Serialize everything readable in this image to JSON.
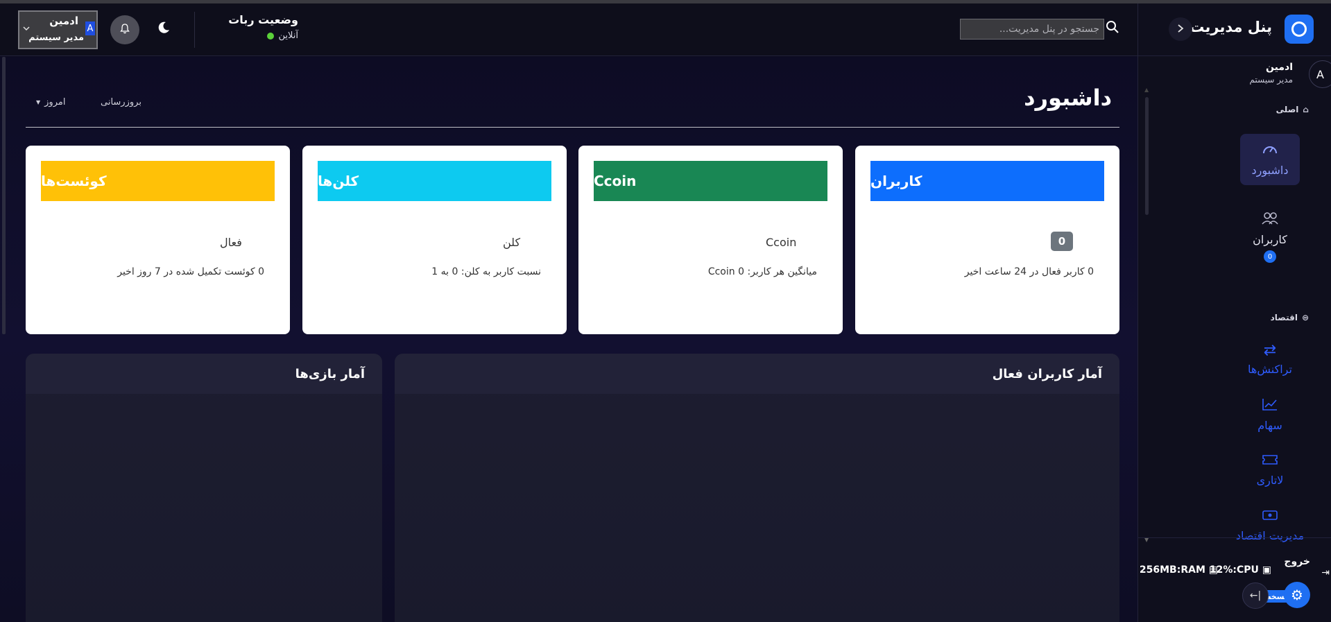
{
  "sidebar": {
    "title": "پنل مدیریت",
    "user": {
      "avatar_letter": "A",
      "name": "ادمین",
      "role": "مدیر سیستم"
    },
    "sections": [
      {
        "label": "اصلی",
        "icon": "home-icon"
      },
      {
        "label": "اقتصاد",
        "icon": "coin-icon"
      }
    ],
    "items": [
      {
        "label": "داشبورد",
        "icon": "gauge-icon",
        "active": true
      },
      {
        "label": "کاربران",
        "icon": "users-icon",
        "badge": "0"
      },
      {
        "label": "تراکنش‌ها",
        "icon": "transfer-icon"
      },
      {
        "label": "سهام",
        "icon": "chart-line-icon"
      },
      {
        "label": "لاتاری",
        "icon": "ticket-icon"
      },
      {
        "label": "مدیریت اقتصاد",
        "icon": "cash-icon"
      }
    ],
    "footer": {
      "cpu": "12%:CPU",
      "ram": "256MB:RAM",
      "logout": "خروج",
      "version": "نسخه 2.0"
    }
  },
  "topbar": {
    "search_placeholder": "جستجو در پنل مدیریت...",
    "bot_status_title": "وضعیت ربات",
    "bot_status_value": "آنلاین",
    "user": {
      "avatar_letter": "A",
      "name": "ادمین",
      "role": "مدیر سیستم"
    }
  },
  "main": {
    "title": "داشبورد",
    "refresh_label": "بروزرسانی",
    "period_label": "امروز",
    "cards": [
      {
        "title": "کاربران",
        "color": "#0d6efd",
        "value": "0",
        "subtitle": "0 کاربر فعال در 24 ساعت اخیر"
      },
      {
        "title": "Ccoin",
        "color": "#198754",
        "value": "Ccoin",
        "subtitle": "میانگین هر کاربر: 0 Ccoin"
      },
      {
        "title": "کلن‌ها",
        "color": "#0dcaf0",
        "value": "کلن",
        "subtitle": "نسبت کاربر به کلن: 0 به 1"
      },
      {
        "title": "کوئست‌ها",
        "color": "#ffc107",
        "value": "فعال",
        "subtitle": "0 کوئست تکمیل شده در 7 روز اخیر"
      }
    ],
    "panels": [
      {
        "title": "آمار کاربران فعال"
      },
      {
        "title": "آمار بازی‌ها"
      }
    ]
  }
}
